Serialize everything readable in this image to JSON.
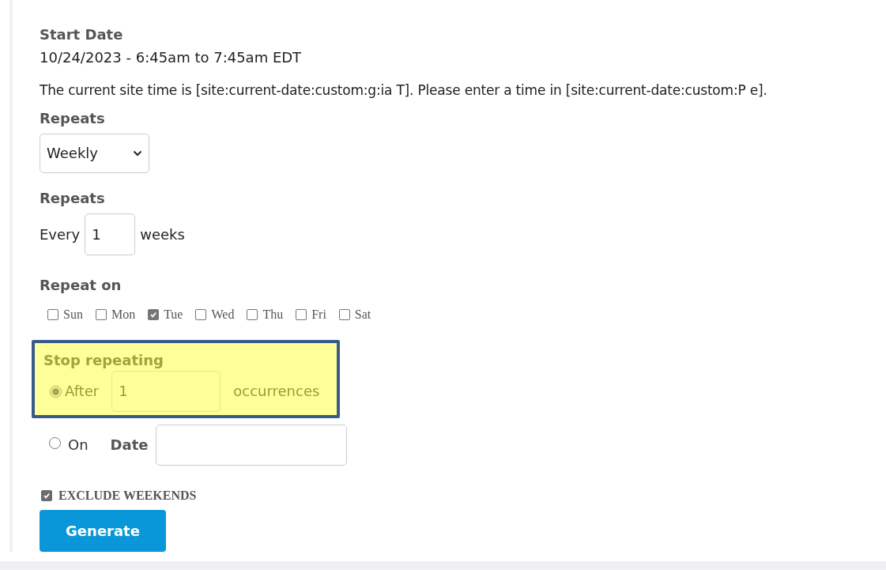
{
  "start_date": {
    "label": "Start Date",
    "value": "10/24/2023 - 6:45am to 7:45am EDT"
  },
  "site_time_note": "The current site time is [site:current-date:custom:g:ia T]. Please enter a time in [site:current-date:custom:P e].",
  "repeats_select": {
    "label": "Repeats",
    "value": "Weekly"
  },
  "interval": {
    "label": "Repeats",
    "prefix": "Every",
    "value": "1",
    "suffix": "weeks"
  },
  "repeat_on": {
    "label": "Repeat on",
    "days": [
      {
        "label": "Sun",
        "checked": false
      },
      {
        "label": "Mon",
        "checked": false
      },
      {
        "label": "Tue",
        "checked": true
      },
      {
        "label": "Wed",
        "checked": false
      },
      {
        "label": "Thu",
        "checked": false
      },
      {
        "label": "Fri",
        "checked": false
      },
      {
        "label": "Sat",
        "checked": false
      }
    ]
  },
  "stop_repeating": {
    "label": "Stop repeating",
    "highlighted": true,
    "options": [
      {
        "kind": "count",
        "label": "After",
        "value": "1",
        "suffix": "occurrences",
        "selected": true
      },
      {
        "kind": "date",
        "label": "On",
        "field_label": "Date",
        "selected": false
      }
    ]
  },
  "exclude_weekends": {
    "label": "EXCLUDE WEEKENDS",
    "checked": true
  },
  "button": "Generate"
}
